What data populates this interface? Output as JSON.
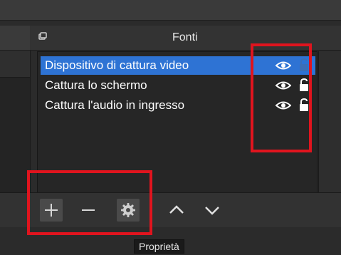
{
  "sources": {
    "title": "Fonti",
    "items": [
      {
        "label": "Dispositivo di cattura video",
        "selected": true
      },
      {
        "label": "Cattura lo schermo",
        "selected": false
      },
      {
        "label": "Cattura l'audio in ingresso",
        "selected": false
      }
    ]
  },
  "toolbar": {
    "add_icon": "plus-icon",
    "remove_icon": "minus-icon",
    "properties_icon": "gear-icon",
    "up_icon": "chevron-up-icon",
    "down_icon": "chevron-down-icon"
  },
  "tooltip": {
    "text": "Proprietà"
  },
  "colors": {
    "selection": "#2e73d4",
    "annotation": "#e0141e",
    "panel": "#262626"
  }
}
